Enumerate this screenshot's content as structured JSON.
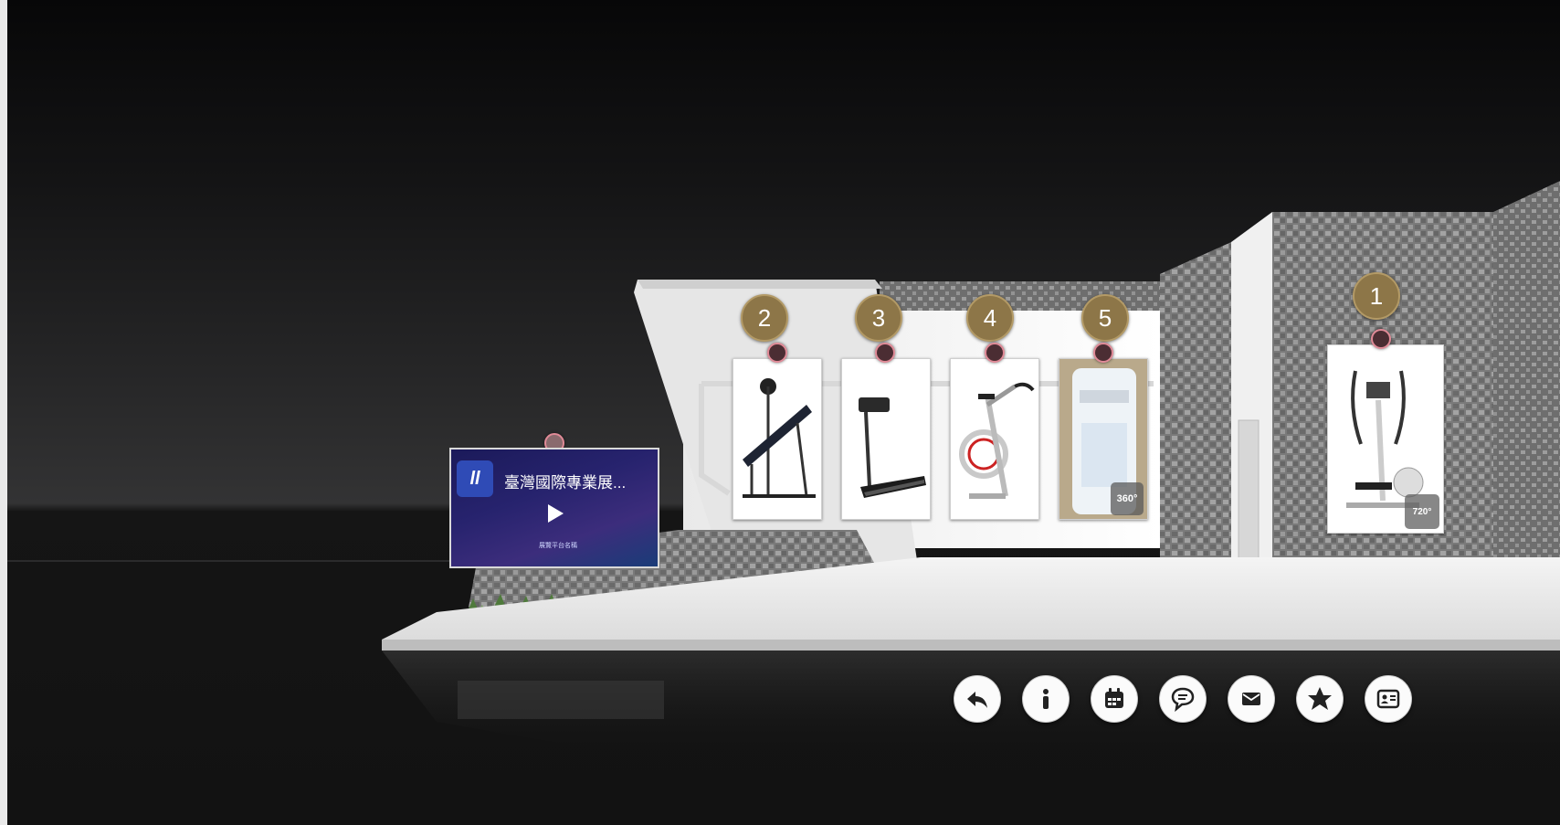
{
  "hotspots": {
    "numbers": [
      "1",
      "2",
      "3",
      "4",
      "5"
    ]
  },
  "video": {
    "title": "臺灣國際專業展...",
    "logo_text": "ll",
    "subtitle": "展覽平台名稱"
  },
  "panels": {
    "badge_360": "360°",
    "badge_720": "720°"
  },
  "toolbar": {
    "icons": [
      "back-arrow-icon",
      "info-icon",
      "calendar-icon",
      "chat-icon",
      "mail-icon",
      "star-icon",
      "business-card-icon"
    ]
  },
  "colors": {
    "number_badge": "#8d7648",
    "hotspot_ring": "#e08a97",
    "background": "#1a1a1b"
  }
}
